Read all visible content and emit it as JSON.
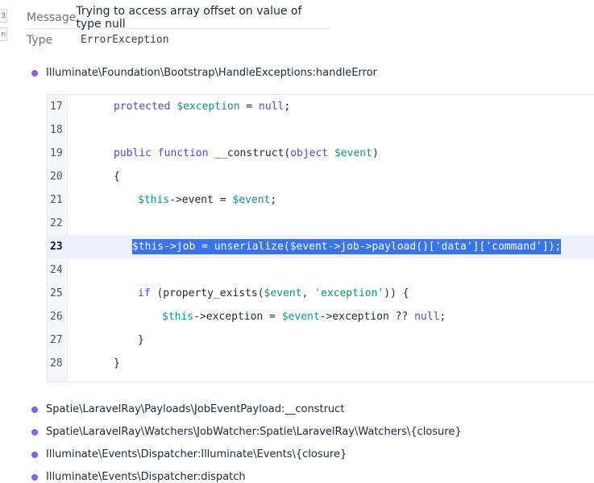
{
  "gutter": {
    "tab_top": "3",
    "tab_bottom": "n"
  },
  "exception": {
    "message_label": "Message",
    "message_value": "Trying to access array offset on value of type null",
    "type_label": "Type",
    "type_value": "ErrorException"
  },
  "stack": {
    "top_frame": "Illuminate\\Foundation\\Bootstrap\\HandleExceptions:handleError",
    "other_frames": [
      "Spatie\\LaravelRay\\Payloads\\JobEventPayload:__construct",
      "Spatie\\LaravelRay\\Watchers\\JobWatcher:Spatie\\LaravelRay\\Watchers\\{closure}",
      "Illuminate\\Events\\Dispatcher:Illuminate\\Events\\{closure}",
      "Illuminate\\Events\\Dispatcher:dispatch"
    ]
  },
  "code": {
    "highlighted_line": 23,
    "line_numbers": [
      "17",
      "18",
      "19",
      "20",
      "21",
      "22",
      "23",
      "24",
      "25",
      "26",
      "27",
      "28"
    ],
    "tokens": {
      "l17_kw": "protected ",
      "l17_var": "$exception",
      "l17_eq": " = ",
      "l17_null": "null",
      "l17_semi": ";",
      "l19_kw1": "public ",
      "l19_kw2": "function ",
      "l19_name": "__construct(",
      "l19_type": "object ",
      "l19_var": "$event",
      "l19_close": ")",
      "l20": "{",
      "l21_var1": "$this",
      "l21_mid": "->event = ",
      "l21_var2": "$event",
      "l21_semi": ";",
      "l23": "$this->job = unserialize($event->job->payload()['data']['command']);",
      "l25_kw": "if ",
      "l25_open": "(property_exists(",
      "l25_var": "$event",
      "l25_comma": ", ",
      "l25_str": "'exception'",
      "l25_close": ")) {",
      "l26_var1": "$this",
      "l26_mid": "->exception = ",
      "l26_var2": "$event",
      "l26_mid2": "->exception ?? ",
      "l26_null": "null",
      "l26_semi": ";",
      "l27": "}",
      "l28": "}"
    }
  },
  "colors": {
    "bullet": "#8b5cf6",
    "selection": "#3b73e8",
    "keyword": "#4f46e5",
    "variable": "#0d9488",
    "string": "#059669"
  }
}
